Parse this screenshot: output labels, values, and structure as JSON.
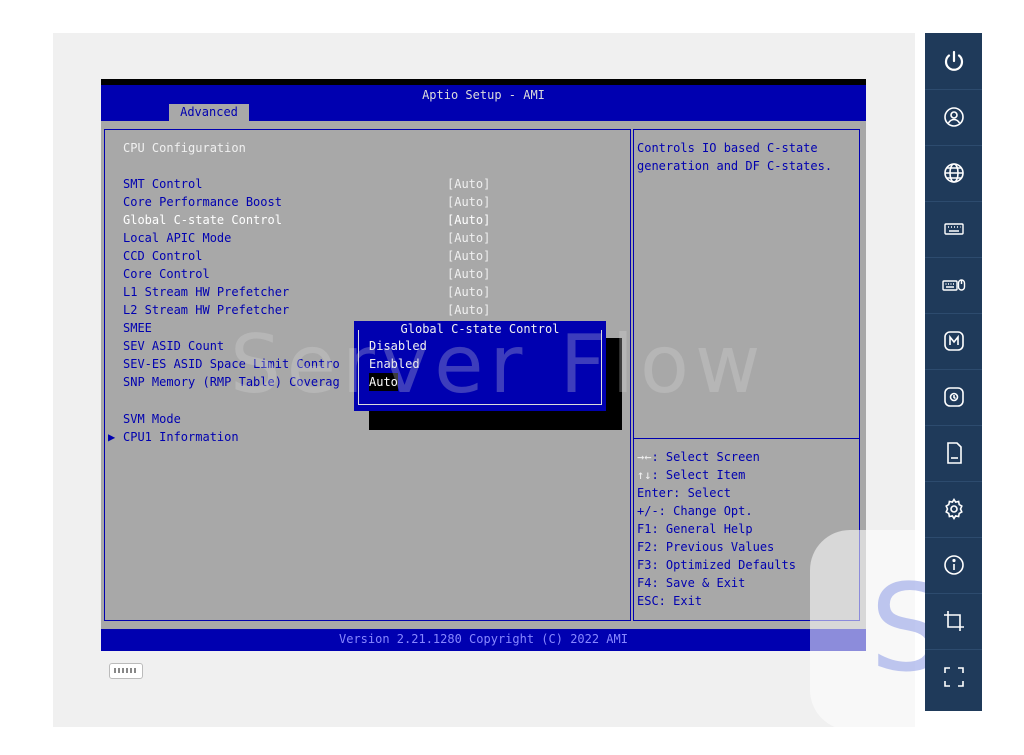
{
  "bios": {
    "title": "Aptio Setup - AMI",
    "tab": "Advanced",
    "section_title": "CPU Configuration",
    "items": [
      {
        "label": "SMT Control",
        "value": "[Auto]"
      },
      {
        "label": "Core Performance Boost",
        "value": "[Auto]"
      },
      {
        "label": "Global C-state Control",
        "value": "[Auto]"
      },
      {
        "label": "Local APIC Mode",
        "value": "[Auto]"
      },
      {
        "label": "CCD Control",
        "value": "[Auto]"
      },
      {
        "label": "Core Control",
        "value": "[Auto]"
      },
      {
        "label": "L1 Stream HW Prefetcher",
        "value": "[Auto]"
      },
      {
        "label": "L2 Stream HW Prefetcher",
        "value": "[Auto]"
      },
      {
        "label": "SMEE",
        "value": ""
      },
      {
        "label": "SEV ASID Count",
        "value": ""
      },
      {
        "label": "SEV-ES ASID Space Limit Contro",
        "value": ""
      },
      {
        "label": "SNP Memory (RMP Table) Coverag",
        "value": ""
      }
    ],
    "svm_mode": "SVM Mode",
    "submenu": "CPU1 Information",
    "help_text": [
      "Controls IO based C-state",
      "generation and DF C-states."
    ],
    "keys": [
      {
        "key": "→←",
        "desc": ": Select Screen"
      },
      {
        "key": "↑↓",
        "desc": ": Select Item"
      },
      {
        "key": "",
        "desc": "Enter: Select"
      },
      {
        "key": "",
        "desc": "+/-: Change Opt."
      },
      {
        "key": "",
        "desc": "F1: General Help"
      },
      {
        "key": "",
        "desc": "F2: Previous Values"
      },
      {
        "key": "",
        "desc": "F3: Optimized Defaults"
      },
      {
        "key": "",
        "desc": "F4: Save & Exit"
      },
      {
        "key": "",
        "desc": "ESC: Exit"
      }
    ],
    "footer": "Version 2.21.1280 Copyright (C) 2022 AMI",
    "popup": {
      "title": "Global C-state Control",
      "options": [
        "Disabled",
        "Enabled",
        "Auto"
      ],
      "selected": "Auto"
    }
  },
  "watermark": {
    "text": "Server Flow",
    "letter": "S"
  },
  "sidebar": [
    {
      "name": "power-icon"
    },
    {
      "name": "user-icon"
    },
    {
      "name": "globe-icon"
    },
    {
      "name": "keyboard-icon"
    },
    {
      "name": "keyboard-mouse-icon"
    },
    {
      "name": "macro-icon"
    },
    {
      "name": "mount-icon"
    },
    {
      "name": "sd-card-icon"
    },
    {
      "name": "settings-icon"
    },
    {
      "name": "info-icon"
    },
    {
      "name": "crop-icon"
    },
    {
      "name": "fullscreen-icon"
    }
  ],
  "colors": {
    "bios_blue": "#0000b0",
    "bios_gray": "#a8a8a8",
    "sidebar": "#1f3a5a"
  }
}
